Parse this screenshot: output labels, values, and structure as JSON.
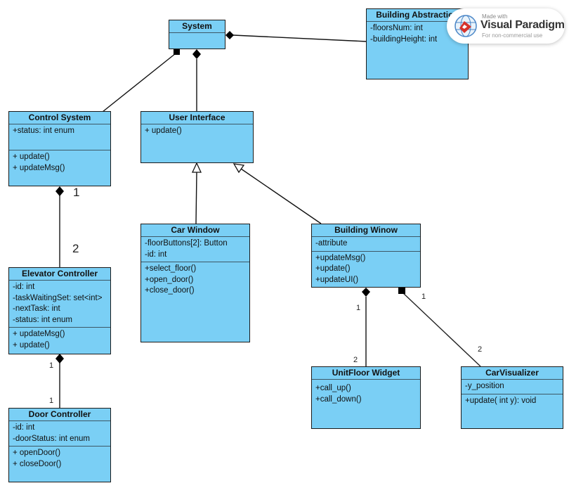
{
  "diagram": {
    "type": "UML class diagram",
    "classes": {
      "system": {
        "name": "System",
        "attributes": [],
        "operations": []
      },
      "building_abstraction": {
        "name": "Building Abstraction",
        "attributes": [
          "-floorsNum: int",
          "-buildingHeight: int"
        ],
        "operations": []
      },
      "control_system": {
        "name": "Control System",
        "attributes": [
          "+status: int enum"
        ],
        "operations": [
          "+ update()",
          "+ updateMsg()"
        ]
      },
      "user_interface": {
        "name": "User Interface",
        "attributes": [],
        "operations": [
          "+ update()"
        ]
      },
      "elevator_controller": {
        "name": "Elevator Controller",
        "attributes": [
          "-id: int",
          "-taskWaitingSet: set<int>",
          "-nextTask: int",
          "-status: int enum"
        ],
        "operations": [
          "+ updateMsg()",
          "+ update()"
        ]
      },
      "car_window": {
        "name": "Car Window",
        "attributes": [
          "-floorButtons[2]: Button",
          "-id: int"
        ],
        "operations": [
          "+select_floor()",
          "+open_door()",
          "+close_door()"
        ]
      },
      "building_window": {
        "name": "Building Winow",
        "attributes": [
          "-attribute"
        ],
        "operations": [
          "+updateMsg()",
          "+update()",
          "+updateUI()"
        ]
      },
      "door_controller": {
        "name": "Door Controller",
        "attributes": [
          "-id: int",
          "-doorStatus: int enum"
        ],
        "operations": [
          "+ openDoor()",
          "+ closeDoor()"
        ]
      },
      "unit_floor_widget": {
        "name": "UnitFloor Widget",
        "attributes": [],
        "operations": [
          "+call_up()",
          "+call_down()"
        ]
      },
      "car_visualizer": {
        "name": "CarVisualizer",
        "attributes": [
          "-y_position"
        ],
        "operations": [
          "+update( int y): void"
        ]
      }
    },
    "relationships": [
      {
        "from": "System",
        "to": "Building Abstraction",
        "kind": "composition"
      },
      {
        "from": "System",
        "to": "Control System",
        "kind": "composition"
      },
      {
        "from": "System",
        "to": "User Interface",
        "kind": "composition"
      },
      {
        "from": "Car Window",
        "to": "User Interface",
        "kind": "generalization"
      },
      {
        "from": "Building Winow",
        "to": "User Interface",
        "kind": "generalization"
      },
      {
        "from": "Control System",
        "to": "Elevator Controller",
        "kind": "composition",
        "source_mult": "1",
        "target_mult": "2"
      },
      {
        "from": "Elevator Controller",
        "to": "Door Controller",
        "kind": "composition",
        "source_mult": "1",
        "target_mult": "1"
      },
      {
        "from": "Building Winow",
        "to": "UnitFloor Widget",
        "kind": "composition",
        "source_mult": "1",
        "target_mult": "2"
      },
      {
        "from": "Building Winow",
        "to": "CarVisualizer",
        "kind": "composition",
        "source_mult": "1",
        "target_mult": "2"
      }
    ],
    "multiplicities": {
      "cs_ec_src": "1",
      "cs_ec_tgt": "2",
      "ec_dc_src": "1",
      "ec_dc_tgt": "1",
      "bw_uf_src": "1",
      "bw_uf_tgt": "2",
      "bw_cv_src": "1",
      "bw_cv_tgt": "2"
    }
  },
  "watermark": {
    "line1": "Made with",
    "line2": "Visual Paradigm",
    "line3": "For non-commercial use"
  },
  "colors": {
    "class_fill": "#7acff5",
    "border": "#1b1b1b",
    "line": "#111111"
  }
}
